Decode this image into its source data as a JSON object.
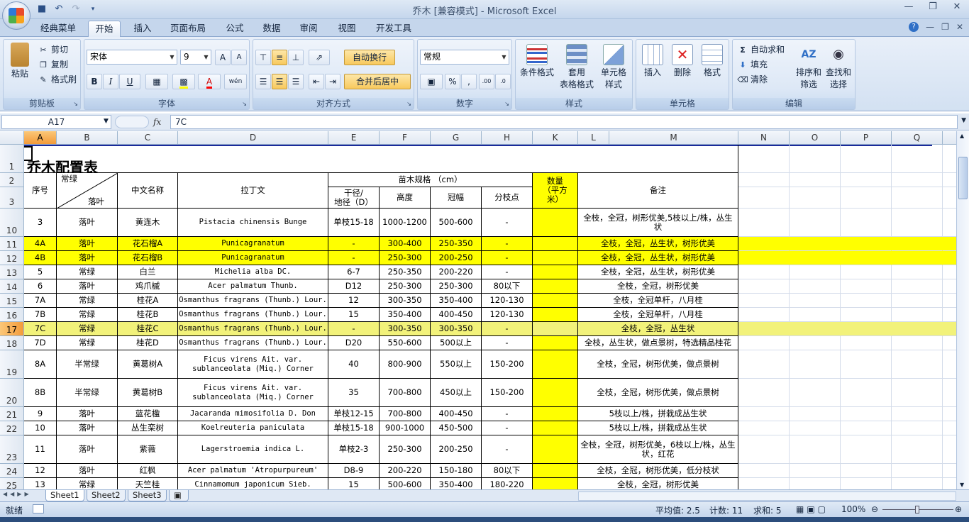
{
  "window": {
    "title": "乔木  [兼容模式] - Microsoft Excel"
  },
  "tabs": [
    "经典菜单",
    "开始",
    "插入",
    "页面布局",
    "公式",
    "数据",
    "审阅",
    "视图",
    "开发工具"
  ],
  "active_tab": "开始",
  "ribbon": {
    "clipboard": {
      "label": "剪贴板",
      "paste": "粘贴",
      "cut": "剪切",
      "copy": "复制",
      "format_painter": "格式刷"
    },
    "font": {
      "label": "字体",
      "name": "宋体",
      "size": "9",
      "bold": "B",
      "italic": "I",
      "underline": "U",
      "grow": "A",
      "shrink": "A",
      "phonetic": "wén"
    },
    "alignment": {
      "label": "对齐方式",
      "wrap": "自动换行",
      "merge": "合并后居中"
    },
    "number": {
      "label": "数字",
      "format": "常规",
      "percent": "%",
      "comma": ","
    },
    "styles": {
      "label": "样式",
      "cond": "条件格式",
      "table1": "套用",
      "table2": "表格格式",
      "cell1": "单元格",
      "cell2": "样式"
    },
    "cells": {
      "label": "单元格",
      "insert": "插入",
      "delete": "删除",
      "format": "格式"
    },
    "editing": {
      "label": "编辑",
      "autosum": "自动求和",
      "fill": "填充",
      "clear": "清除",
      "sort1": "排序和",
      "sort2": "筛选",
      "find1": "查找和",
      "find2": "选择"
    }
  },
  "formula_bar": {
    "name_box": "A17",
    "fx": "fx",
    "value": "7C"
  },
  "columns": [
    "A",
    "B",
    "C",
    "D",
    "E",
    "F",
    "G",
    "H",
    "K",
    "L",
    "M",
    "N",
    "O",
    "P",
    "Q"
  ],
  "rows": [
    "1",
    "2",
    "3",
    "10",
    "11",
    "12",
    "13",
    "14",
    "15",
    "16",
    "17",
    "18",
    "19",
    "20",
    "21",
    "22",
    "23",
    "24",
    "25"
  ],
  "sheet": {
    "title": "乔木配置表",
    "headers": {
      "seq": "序号",
      "evergreen": "常绿",
      "deciduous": "落叶",
      "cn": "中文名称",
      "latin": "拉丁文",
      "spec": "苗木规格 （cm）",
      "trunk": "干径/\n地径（D）",
      "height": "高度",
      "crown": "冠幅",
      "branch": "分枝点",
      "qty": "数量\n（平方\n米）",
      "note": "备注"
    },
    "data": [
      [
        "3",
        "落叶",
        "黄连木",
        "Pistacia chinensis Bunge",
        "单枝15-18",
        "1000-1200",
        "500-600",
        "-",
        "",
        "全枝，全冠，树形优美,5枝以上/株，丛生状"
      ],
      [
        "4A",
        "落叶",
        "花石榴A",
        "Punicagranatum",
        "-",
        "300-400",
        "250-350",
        "-",
        "",
        "全枝，全冠，丛生状，树形优美"
      ],
      [
        "4B",
        "落叶",
        "花石榴B",
        "Punicagranatum",
        "-",
        "250-300",
        "200-250",
        "-",
        "",
        "全枝，全冠，丛生状，树形优美"
      ],
      [
        "5",
        "常绿",
        "白兰",
        "Michelia alba DC.",
        "6-7",
        "250-350",
        "200-220",
        "-",
        "",
        "全枝，全冠，丛生状，树形优美"
      ],
      [
        "6",
        "落叶",
        "鸡爪槭",
        "Acer palmatum Thunb.",
        "D12",
        "250-300",
        "250-300",
        "80以下",
        "",
        "全枝，全冠，树形优美"
      ],
      [
        "7A",
        "常绿",
        "桂花A",
        "Osmanthus fragrans (Thunb.) Lour.",
        "12",
        "300-350",
        "350-400",
        "120-130",
        "",
        "全枝，全冠单杆，八月桂"
      ],
      [
        "7B",
        "常绿",
        "桂花B",
        "Osmanthus fragrans (Thunb.) Lour.",
        "15",
        "350-400",
        "400-450",
        "120-130",
        "",
        "全枝，全冠单杆，八月桂"
      ],
      [
        "7C",
        "常绿",
        "桂花C",
        "Osmanthus fragrans (Thunb.) Lour.",
        "-",
        "300-350",
        "300-350",
        "-",
        "",
        "全枝，全冠，丛生状"
      ],
      [
        "7D",
        "常绿",
        "桂花D",
        "Osmanthus fragrans (Thunb.) Lour.",
        "D20",
        "550-600",
        "500以上",
        "-",
        "",
        "全枝，丛生状，做点景树，特选精品桂花"
      ],
      [
        "8A",
        "半常绿",
        "黄葛树A",
        "Ficus virens Ait. var. sublanceolata (Miq.) Corner",
        "40",
        "800-900",
        "550以上",
        "150-200",
        "",
        "全枝，全冠，树形优美，做点景树"
      ],
      [
        "8B",
        "半常绿",
        "黄葛树B",
        "Ficus virens Ait. var. sublanceolata (Miq.) Corner",
        "35",
        "700-800",
        "450以上",
        "150-200",
        "",
        "全枝，全冠，树形优美，做点景树"
      ],
      [
        "9",
        "落叶",
        "蓝花楹",
        "Jacaranda mimosifolia D. Don",
        "单枝12-15",
        "700-800",
        "400-450",
        "-",
        "",
        "5枝以上/株，拼栽成丛生状"
      ],
      [
        "10",
        "落叶",
        "丛生栾树",
        "Koelreuteria paniculata",
        "单枝15-18",
        "900-1000",
        "450-500",
        "-",
        "",
        "5枝以上/株，拼栽成丛生状"
      ],
      [
        "11",
        "落叶",
        "紫薇",
        "Lagerstroemia indica L.",
        "单枝2-3",
        "250-300",
        "200-250",
        "-",
        "",
        "全枝，全冠，树形优美，6枝以上/株，丛生状，红花"
      ],
      [
        "12",
        "落叶",
        "红枫",
        "Acer palmatum 'Atropurpureum'",
        "D8-9",
        "200-220",
        "150-180",
        "80以下",
        "",
        "全枝，全冠，树形优美，低分枝状"
      ],
      [
        "13",
        "常绿",
        "天竺桂",
        "Cinnamomum japonicum Sieb.",
        "15",
        "500-600",
        "350-400",
        "180-220",
        "",
        "全枝，全冠，树形优美"
      ]
    ]
  },
  "sheet_tabs": [
    "Sheet1",
    "Sheet2",
    "Sheet3"
  ],
  "status": {
    "ready": "就绪",
    "avg": "平均值: 2.5",
    "count": "计数: 11",
    "sum": "求和: 5",
    "zoom": "100%"
  },
  "colors": {
    "highlight": "#ffff00",
    "selected_header": "#f5a54a",
    "ribbon": "#d3e1f2"
  }
}
